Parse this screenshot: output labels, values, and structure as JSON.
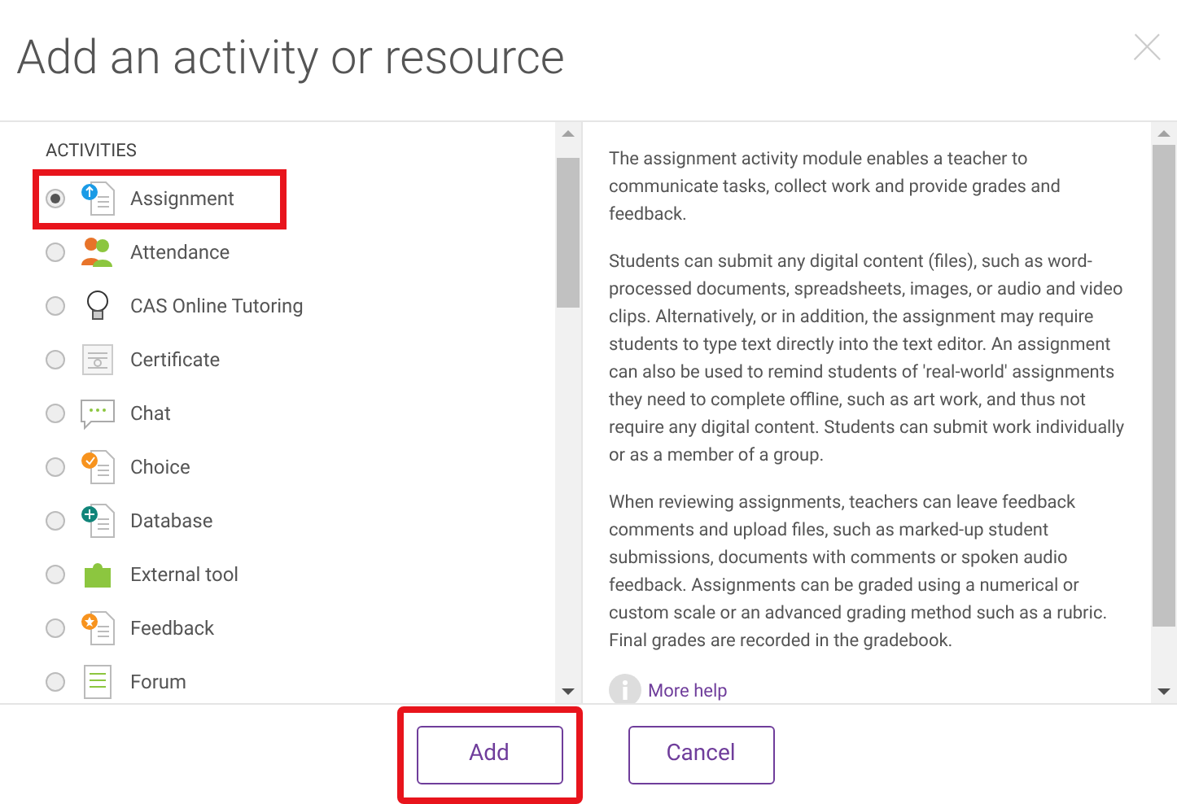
{
  "dialog": {
    "title": "Add an activity or resource",
    "close": "×"
  },
  "activities": {
    "heading": "ACTIVITIES",
    "items": [
      {
        "label": "Assignment",
        "selected": true,
        "highlighted": true
      },
      {
        "label": "Attendance",
        "selected": false,
        "highlighted": false
      },
      {
        "label": "CAS Online Tutoring",
        "selected": false,
        "highlighted": false
      },
      {
        "label": "Certificate",
        "selected": false,
        "highlighted": false
      },
      {
        "label": "Chat",
        "selected": false,
        "highlighted": false
      },
      {
        "label": "Choice",
        "selected": false,
        "highlighted": false
      },
      {
        "label": "Database",
        "selected": false,
        "highlighted": false
      },
      {
        "label": "External tool",
        "selected": false,
        "highlighted": false
      },
      {
        "label": "Feedback",
        "selected": false,
        "highlighted": false
      },
      {
        "label": "Forum",
        "selected": false,
        "highlighted": false
      }
    ]
  },
  "description": {
    "paragraphs": [
      "The assignment activity module enables a teacher to communicate tasks, collect work and provide grades and feedback.",
      "Students can submit any digital content (files), such as word-processed documents, spreadsheets, images, or audio and video clips. Alternatively, or in addition, the assignment may require students to type text directly into the text editor. An assignment can also be used to remind students of 'real-world' assignments they need to complete offline, such as art work, and thus not require any digital content. Students can submit work individually or as a member of a group.",
      "When reviewing assignments, teachers can leave feedback comments and upload files, such as marked-up student submissions, documents with comments or spoken audio feedback. Assignments can be graded using a numerical or custom scale or an advanced grading method such as a rubric. Final grades are recorded in the gradebook."
    ],
    "more_help": "More help"
  },
  "buttons": [
    {
      "label": "Add",
      "highlighted": true
    },
    {
      "label": "Cancel",
      "highlighted": false
    }
  ]
}
